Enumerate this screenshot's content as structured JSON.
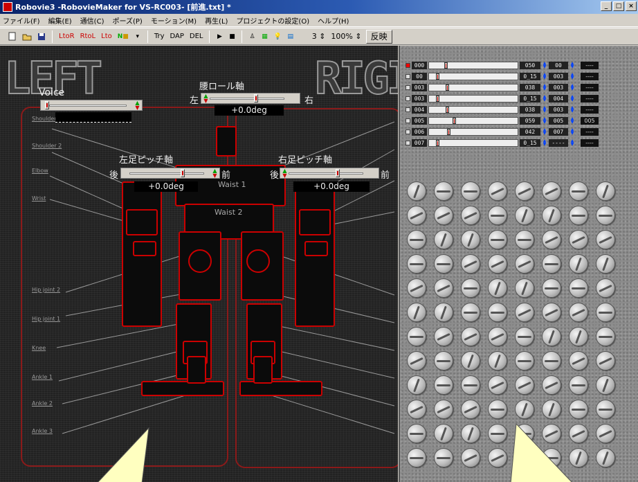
{
  "window": {
    "title": "Robovie3 -RobovieMaker for VS-RC003- [前進.txt] *",
    "min": "_",
    "max": "□",
    "close": "×"
  },
  "menu": [
    "ファイル(F)",
    "編集(E)",
    "通信(C)",
    "ポーズ(P)",
    "モーション(M)",
    "再生(L)",
    "プロジェクトの設定(O)",
    "ヘルプ(H)"
  ],
  "toolbar": {
    "tools": [
      "LtoR",
      "RtoL",
      "Lto",
      "Try",
      "DAP",
      "DEL"
    ],
    "page": "3",
    "zoom": "100%",
    "reflect_button": "反映"
  },
  "left": {
    "big_left": "LEFT",
    "big_right": "RIGI",
    "voice": "Voice",
    "waist_roll": {
      "title": "腰ロール軸",
      "left": "左",
      "right": "右",
      "value": "+0.0deg"
    },
    "left_pitch": {
      "title": "左足ピッチ軸",
      "back": "後",
      "front": "前",
      "value": "+0.0deg"
    },
    "right_pitch": {
      "title": "右足ピッチ軸",
      "back": "後",
      "front": "前",
      "value": "+0.0deg"
    },
    "waist1": "Waist 1",
    "waist2": "Waist 2",
    "parts": [
      "Shoulder 1",
      "Shoulder 2",
      "Elbow",
      "Wrist",
      "Hip joint 2",
      "Hip joint 1",
      "Knee",
      "Ankle 1",
      "Ankle 2",
      "Ankle 3"
    ]
  },
  "channels": [
    {
      "id": "000",
      "value": "050",
      "v2": "00",
      "d": "----",
      "active": true,
      "pos": 0.18
    },
    {
      "id": "00",
      "value": "0_15",
      "v2": "003",
      "d": "----",
      "active": false,
      "pos": 0.08
    },
    {
      "id": "003",
      "value": "038",
      "v2": "003",
      "d": "----",
      "active": false,
      "pos": 0.2
    },
    {
      "id": "003",
      "value": "0_15",
      "v2": "004",
      "d": "----",
      "active": false,
      "pos": 0.08
    },
    {
      "id": "004",
      "value": "038",
      "v2": "003",
      "d": "----",
      "active": false,
      "pos": 0.2
    },
    {
      "id": "005",
      "value": "059",
      "v2": "005",
      "d": "005",
      "active": false,
      "pos": 0.28
    },
    {
      "id": "006",
      "value": "042",
      "v2": "007",
      "d": "----",
      "active": false,
      "pos": 0.22
    },
    {
      "id": "007",
      "value": "0_15",
      "v2": "----",
      "d": "----",
      "active": false,
      "pos": 0.08
    }
  ],
  "colors": {
    "accent": "#cc0000",
    "titlebar": "#0a246a"
  }
}
